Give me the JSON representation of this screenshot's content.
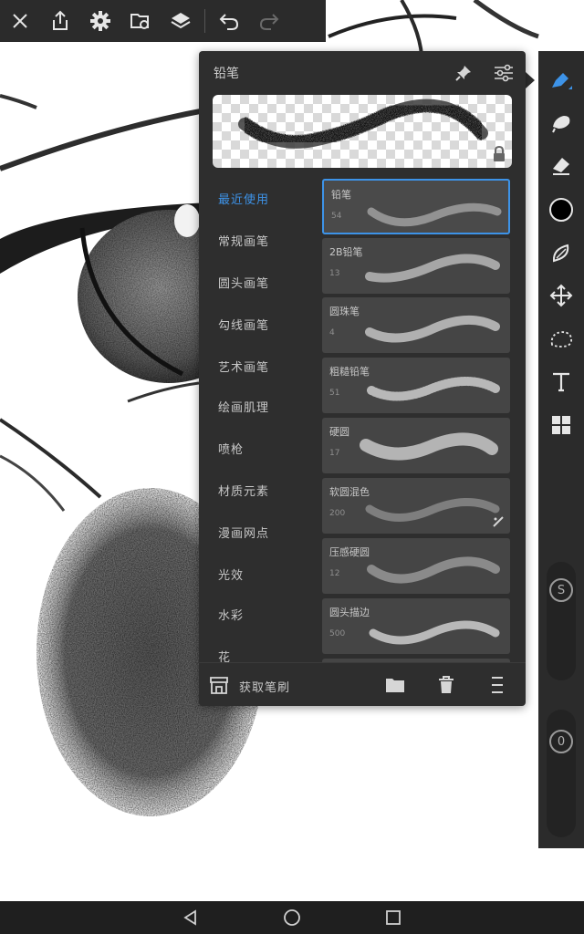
{
  "top_toolbar": {
    "icons": [
      "close-icon",
      "share-icon",
      "gear-icon",
      "gallery-icon",
      "layers-icon",
      "undo-icon",
      "redo-icon"
    ]
  },
  "brush_panel": {
    "title": "铅笔",
    "categories": [
      {
        "label": "最近使用",
        "active": true
      },
      {
        "label": "常规画笔",
        "active": false
      },
      {
        "label": "圆头画笔",
        "active": false
      },
      {
        "label": "勾线画笔",
        "active": false
      },
      {
        "label": "艺术画笔",
        "active": false
      },
      {
        "label": "绘画肌理",
        "active": false
      },
      {
        "label": "喷枪",
        "active": false
      },
      {
        "label": "材质元素",
        "active": false
      },
      {
        "label": "漫画网点",
        "active": false
      },
      {
        "label": "光效",
        "active": false
      },
      {
        "label": "水彩",
        "active": false
      },
      {
        "label": "花",
        "active": false
      }
    ],
    "brushes": [
      {
        "name": "铅笔",
        "size": "54",
        "selected": true
      },
      {
        "name": "2B铅笔",
        "size": "13",
        "selected": false
      },
      {
        "name": "圆珠笔",
        "size": "4",
        "selected": false
      },
      {
        "name": "粗糙铅笔",
        "size": "51",
        "selected": false
      },
      {
        "name": "硬圆",
        "size": "17",
        "selected": false
      },
      {
        "name": "软圆混色",
        "size": "200",
        "selected": false
      },
      {
        "name": "压感硬圆",
        "size": "12",
        "selected": false
      },
      {
        "name": "圆头描边",
        "size": "500",
        "selected": false
      }
    ],
    "footer": {
      "get_brush_label": "获取笔刷"
    }
  },
  "tool_rail": {
    "tools": [
      "brush-icon",
      "smudge-icon",
      "eraser-icon",
      "color-swatch",
      "lasso-fill-icon",
      "move-icon",
      "selection-icon",
      "text-icon",
      "layout-icon"
    ],
    "color": "#000000",
    "size_slider_label": "S",
    "opacity_slider_label": "0"
  },
  "colors": {
    "accent": "#3d93e8",
    "panel_bg": "#2e2e2e",
    "toolbar_bg": "#2b2b2b"
  }
}
